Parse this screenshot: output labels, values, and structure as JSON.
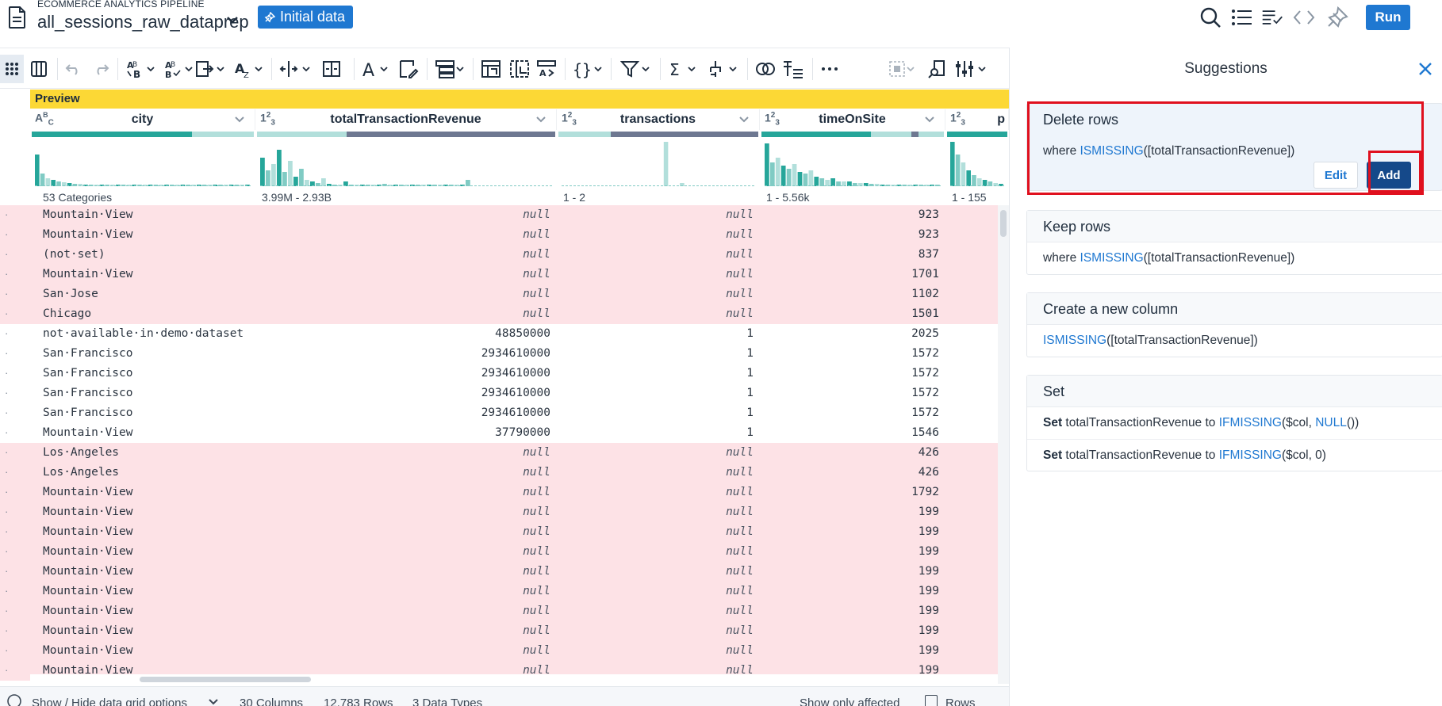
{
  "header": {
    "pipeline_label": "ECOMMERCE ANALYTICS PIPELINE",
    "recipe_name": "all_sessions_raw_dataprep",
    "initial_data_label": "Initial data",
    "run_label": "Run"
  },
  "grid": {
    "preview_label": "Preview",
    "columns": [
      {
        "type": "string",
        "name": "city",
        "range": "53 Categories"
      },
      {
        "type": "integer",
        "name": "totalTransactionRevenue",
        "range": "3.99M - 2.93B"
      },
      {
        "type": "integer",
        "name": "transactions",
        "range": "1 - 2"
      },
      {
        "type": "integer",
        "name": "timeOnSite",
        "range": "1 - 5.56k"
      },
      {
        "type": "integer",
        "name": "p",
        "range": "1 - 155"
      }
    ],
    "rows": [
      {
        "city": "Mountain·View",
        "revenue": "null",
        "transactions": "null",
        "time": "923",
        "missing": true
      },
      {
        "city": "Mountain·View",
        "revenue": "null",
        "transactions": "null",
        "time": "923",
        "missing": true
      },
      {
        "city": "(not·set)",
        "revenue": "null",
        "transactions": "null",
        "time": "837",
        "missing": true
      },
      {
        "city": "Mountain·View",
        "revenue": "null",
        "transactions": "null",
        "time": "1701",
        "missing": true
      },
      {
        "city": "San·Jose",
        "revenue": "null",
        "transactions": "null",
        "time": "1102",
        "missing": true
      },
      {
        "city": "Chicago",
        "revenue": "null",
        "transactions": "null",
        "time": "1501",
        "missing": true
      },
      {
        "city": "not·available·in·demo·dataset",
        "revenue": "48850000",
        "transactions": "1",
        "time": "2025",
        "missing": false
      },
      {
        "city": "San·Francisco",
        "revenue": "2934610000",
        "transactions": "1",
        "time": "1572",
        "missing": false
      },
      {
        "city": "San·Francisco",
        "revenue": "2934610000",
        "transactions": "1",
        "time": "1572",
        "missing": false
      },
      {
        "city": "San·Francisco",
        "revenue": "2934610000",
        "transactions": "1",
        "time": "1572",
        "missing": false
      },
      {
        "city": "San·Francisco",
        "revenue": "2934610000",
        "transactions": "1",
        "time": "1572",
        "missing": false
      },
      {
        "city": "Mountain·View",
        "revenue": "37790000",
        "transactions": "1",
        "time": "1546",
        "missing": false
      },
      {
        "city": "Los·Angeles",
        "revenue": "null",
        "transactions": "null",
        "time": "426",
        "missing": true
      },
      {
        "city": "Los·Angeles",
        "revenue": "null",
        "transactions": "null",
        "time": "426",
        "missing": true
      },
      {
        "city": "Mountain·View",
        "revenue": "null",
        "transactions": "null",
        "time": "1792",
        "missing": true
      },
      {
        "city": "Mountain·View",
        "revenue": "null",
        "transactions": "null",
        "time": "199",
        "missing": true
      },
      {
        "city": "Mountain·View",
        "revenue": "null",
        "transactions": "null",
        "time": "199",
        "missing": true
      },
      {
        "city": "Mountain·View",
        "revenue": "null",
        "transactions": "null",
        "time": "199",
        "missing": true
      },
      {
        "city": "Mountain·View",
        "revenue": "null",
        "transactions": "null",
        "time": "199",
        "missing": true
      },
      {
        "city": "Mountain·View",
        "revenue": "null",
        "transactions": "null",
        "time": "199",
        "missing": true
      },
      {
        "city": "Mountain·View",
        "revenue": "null",
        "transactions": "null",
        "time": "199",
        "missing": true
      },
      {
        "city": "Mountain·View",
        "revenue": "null",
        "transactions": "null",
        "time": "199",
        "missing": true
      },
      {
        "city": "Mountain·View",
        "revenue": "null",
        "transactions": "null",
        "time": "199",
        "missing": true
      },
      {
        "city": "Mountain·View",
        "revenue": "null",
        "transactions": "null",
        "time": "199",
        "missing": true
      }
    ]
  },
  "footer": {
    "grid_options": "Show / Hide data grid options",
    "columns": "30 Columns",
    "rows": "12,783 Rows",
    "types": "3 Data Types",
    "only_affected": "Show only affected",
    "rows_checkbox": "Rows"
  },
  "suggestions": {
    "title": "Suggestions",
    "delete": {
      "title": "Delete rows",
      "prefix": "where ",
      "fn": "ISMISSING",
      "arg": "([totalTransactionRevenue])",
      "edit_label": "Edit",
      "add_label": "Add"
    },
    "keep": {
      "title": "Keep rows",
      "prefix": "where ",
      "fn": "ISMISSING",
      "arg": "([totalTransactionRevenue])"
    },
    "create": {
      "title": "Create a new column",
      "fn": "ISMISSING",
      "arg": "([totalTransactionRevenue])"
    },
    "set": {
      "title": "Set",
      "line1": {
        "kw": "Set",
        "text": " totalTransactionRevenue to ",
        "fn": "IFMISSING",
        "open": "($col, ",
        "fn2": "NULL",
        "close": "())"
      },
      "line2": {
        "kw": "Set",
        "text": " totalTransactionRevenue to ",
        "fn": "IFMISSING",
        "rest": "($col, 0)"
      }
    }
  },
  "colors": {
    "accent": "#1f78d1",
    "add_button": "#15498a",
    "preview": "#fcd835",
    "missing_row": "#fde2e6",
    "histogram": "#26a69a",
    "highlight": "#e0101e"
  }
}
